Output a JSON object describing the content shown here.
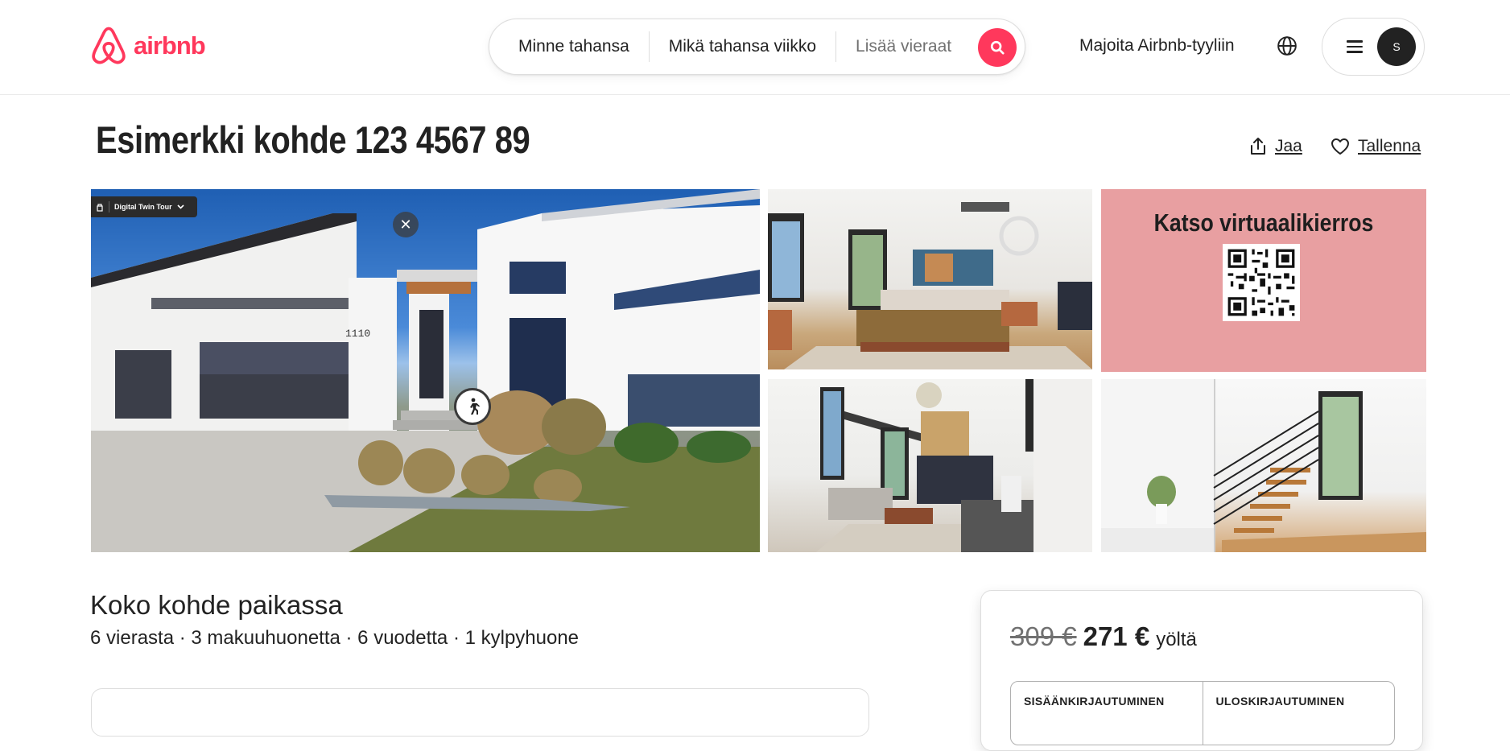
{
  "header": {
    "logo_text": "airbnb",
    "search": {
      "location": "Minne tahansa",
      "week": "Mikä tahansa viikko",
      "guests_placeholder": "Lisää vieraat"
    },
    "host_link": "Majoita Airbnb-tyyliin",
    "avatar_initial": "S"
  },
  "listing": {
    "title": "Esimerkki kohde 123 4567 89",
    "share_label": "Jaa",
    "save_label": "Tallenna"
  },
  "gallery": {
    "tour_chip_label": "Digital Twin Tour",
    "house_number": "1110",
    "virtual_tour_label": "Katso virtuaalikierros"
  },
  "details": {
    "subtitle": "Koko kohde paikassa",
    "summary": "6 vierasta · 3 makuuhuonetta · 6 vuodetta · 1 kylpyhuone"
  },
  "booking": {
    "old_price": "309 €",
    "new_price": "271 €",
    "per_label": "yöltä",
    "checkin_label": "SISÄÄNKIRJAUTUMINEN",
    "checkout_label": "ULOSKIRJAUTUMINEN"
  },
  "colors": {
    "brand": "#ff385c",
    "virtual_tour_bg": "#e89fa1",
    "text": "#222222",
    "muted": "#717171"
  },
  "icons": [
    "airbnb-logo-icon",
    "search-icon",
    "globe-icon",
    "menu-icon",
    "share-icon",
    "heart-icon",
    "close-icon",
    "walk-icon",
    "qr-code-icon",
    "chevron-down-icon"
  ]
}
